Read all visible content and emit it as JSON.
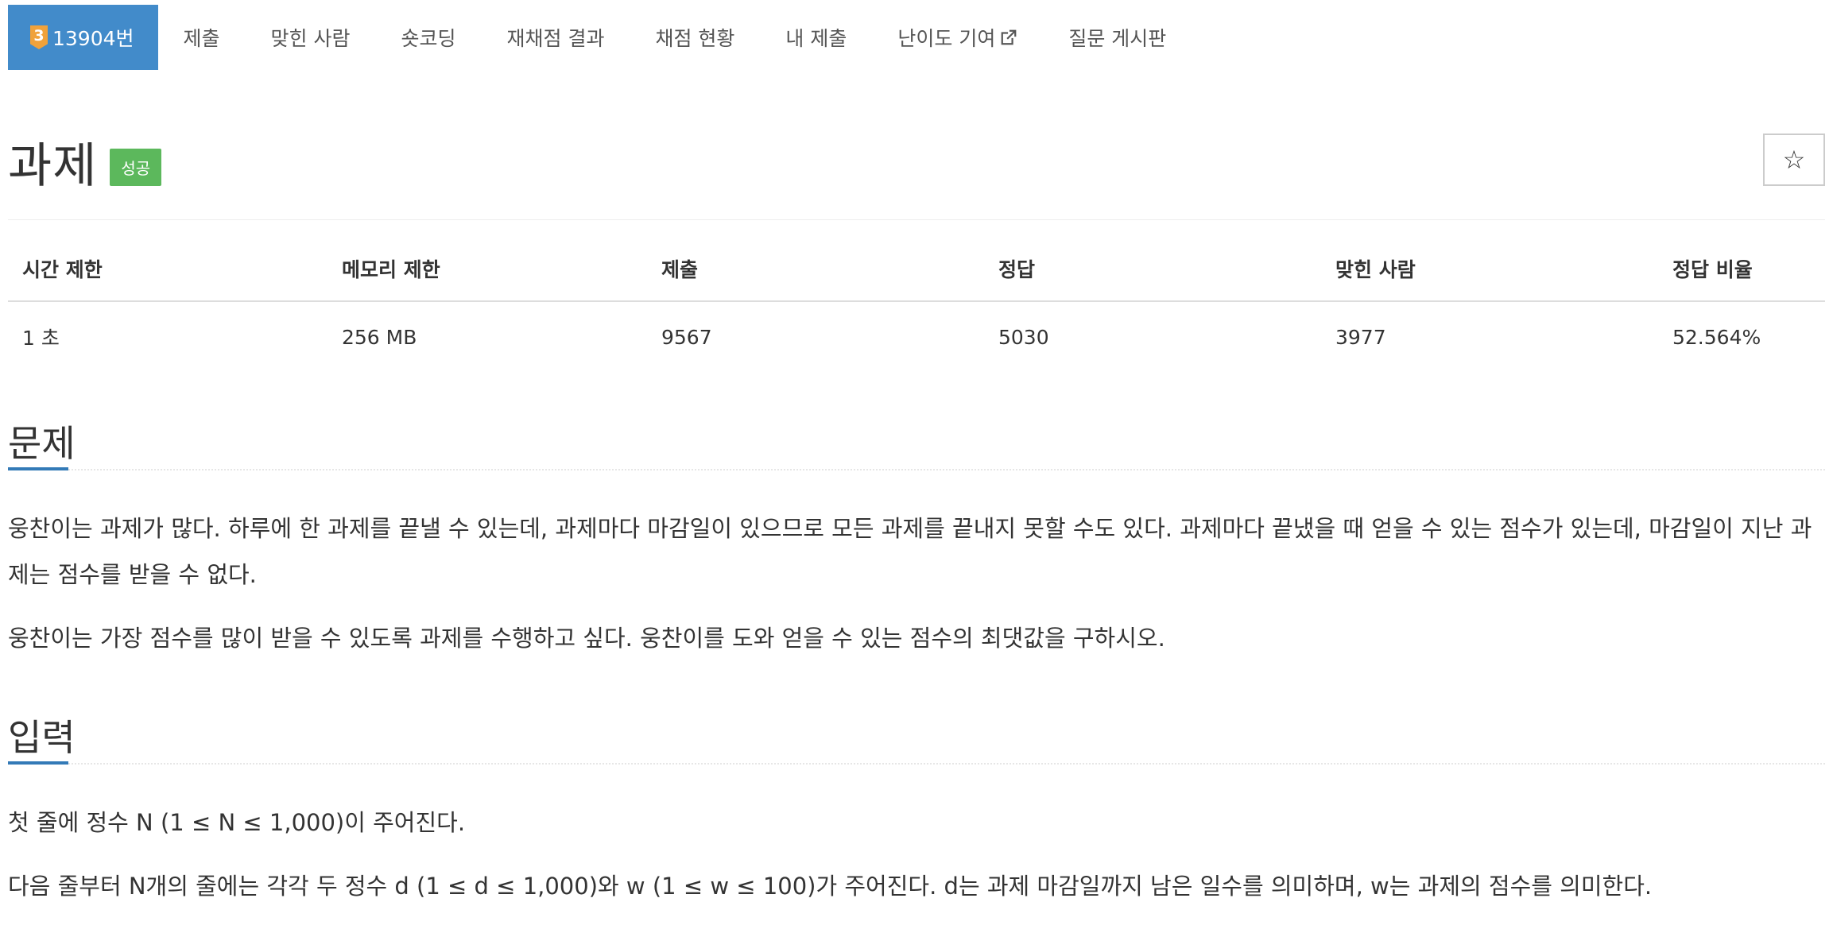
{
  "nav": {
    "tier_number": "3",
    "problem_id": "13904번",
    "items": [
      "제출",
      "맞힌 사람",
      "숏코딩",
      "재채점 결과",
      "채점 현황",
      "내 제출",
      "난이도 기여",
      "질문 게시판"
    ]
  },
  "title": {
    "text": "과제",
    "status": "성공",
    "star": "☆"
  },
  "info_table": {
    "headers": [
      "시간 제한",
      "메모리 제한",
      "제출",
      "정답",
      "맞힌 사람",
      "정답 비율"
    ],
    "values": [
      "1 초",
      "256 MB",
      "9567",
      "5030",
      "3977",
      "52.564%"
    ]
  },
  "sections": {
    "problem": {
      "title": "문제",
      "paragraphs": [
        "웅찬이는 과제가 많다. 하루에 한 과제를 끝낼 수 있는데, 과제마다 마감일이 있으므로 모든 과제를 끝내지 못할 수도 있다. 과제마다 끝냈을 때 얻을 수 있는 점수가 있는데, 마감일이 지난 과제는 점수를 받을 수 없다.",
        "웅찬이는 가장 점수를 많이 받을 수 있도록 과제를 수행하고 싶다. 웅찬이를 도와 얻을 수 있는 점수의 최댓값을 구하시오."
      ]
    },
    "input": {
      "title": "입력",
      "paragraphs": [
        "첫 줄에 정수 N (1 ≤ N ≤ 1,000)이 주어진다.",
        "다음 줄부터 N개의 줄에는 각각 두 정수 d (1 ≤ d ≤ 1,000)와 w (1 ≤ w ≤ 100)가 주어진다. d는 과제 마감일까지 남은 일수를 의미하며, w는 과제의 점수를 의미한다."
      ]
    }
  },
  "colors": {
    "nav_active": "#428bca",
    "tier_gold": "#f0a23b",
    "status_success": "#5cb85c",
    "section_accent": "#337ab7"
  },
  "icons": {
    "tier": "tier-gold-badge",
    "external_link": "external-link-icon",
    "star": "star-outline-icon"
  }
}
